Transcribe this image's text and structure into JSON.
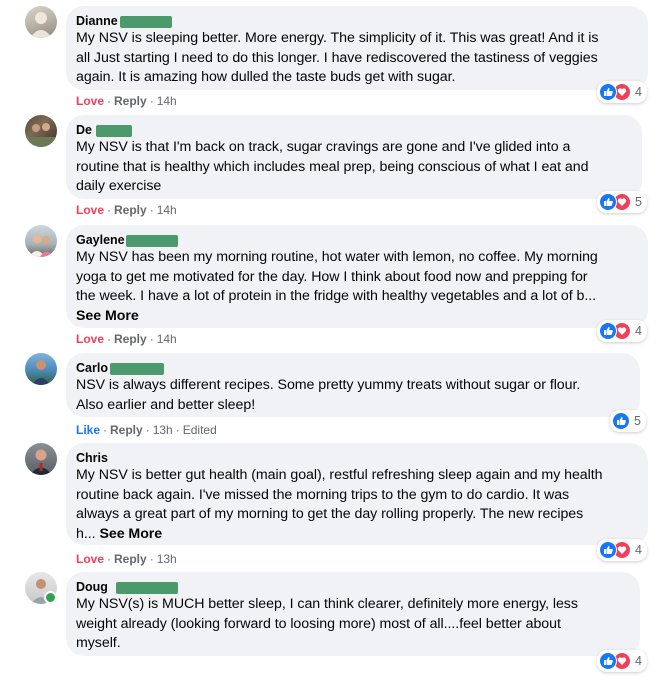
{
  "comments": [
    {
      "author": "Dianne",
      "text": "My NSV is sleeping better. More energy. The simplicity of it. This was great! And it is\nall Just starting I need to do this longer. I have rediscovered the tastiness of veggies\nagain. It is amazing how dulled the taste buds get with sugar.",
      "see_more": "",
      "reaction_label": "Love",
      "reply_label": "Reply",
      "time": "14h",
      "edited": "",
      "reaction_count": "4"
    },
    {
      "author": "De",
      "text": "My NSV is that I'm back on track, sugar cravings are gone and I've glided into a\nroutine that is healthy which includes meal prep, being conscious of what I eat and\ndaily exercise",
      "see_more": "",
      "reaction_label": "Love",
      "reply_label": "Reply",
      "time": "14h",
      "edited": "",
      "reaction_count": "5"
    },
    {
      "author": "Gaylene",
      "text": "My NSV has been my morning routine, hot water with lemon, no coffee. My morning\nyoga to get me motivated for the day. How I think about food now and prepping for\nthe week. I have a lot of protein in the fridge with healthy vegetables and a lot of b...",
      "see_more": "See More",
      "reaction_label": "Love",
      "reply_label": "Reply",
      "time": "14h",
      "edited": "",
      "reaction_count": "4"
    },
    {
      "author": "Carlo",
      "text": "NSV is always different recipes. Some pretty yummy treats without sugar or flour.\nAlso earlier and better sleep!",
      "see_more": "",
      "reaction_label": "Like",
      "reply_label": "Reply",
      "time": "13h",
      "edited": "Edited",
      "reaction_count": "5"
    },
    {
      "author": "Chris",
      "text": "My NSV is better gut health (main goal), restful refreshing sleep again and my health\nroutine back again. I've missed the morning trips to the gym to do cardio. It was\nalways a great part of my morning to get the day rolling properly. The new recipes\nh...",
      "see_more": "See More",
      "reaction_label": "Love",
      "reply_label": "Reply",
      "time": "13h",
      "edited": "",
      "reaction_count": "4"
    },
    {
      "author": "Doug",
      "text": "My NSV(s) is MUCH better sleep, I can think clearer, definitely more energy, less\nweight already (looking forward to loosing more) most of all....feel better about\nmyself.",
      "see_more": "",
      "reaction_label": "",
      "reply_label": "",
      "time": "",
      "edited": "",
      "reaction_count": "4"
    }
  ],
  "colors": {
    "bubble": "#f0f2f5",
    "love": "#f33e58",
    "like": "#1877f2",
    "meta": "#65676b",
    "redaction": "#4c9a6b",
    "online": "#31a24c"
  },
  "icons": {
    "like_reaction": "thumbs-up-icon",
    "love_reaction": "heart-icon"
  }
}
